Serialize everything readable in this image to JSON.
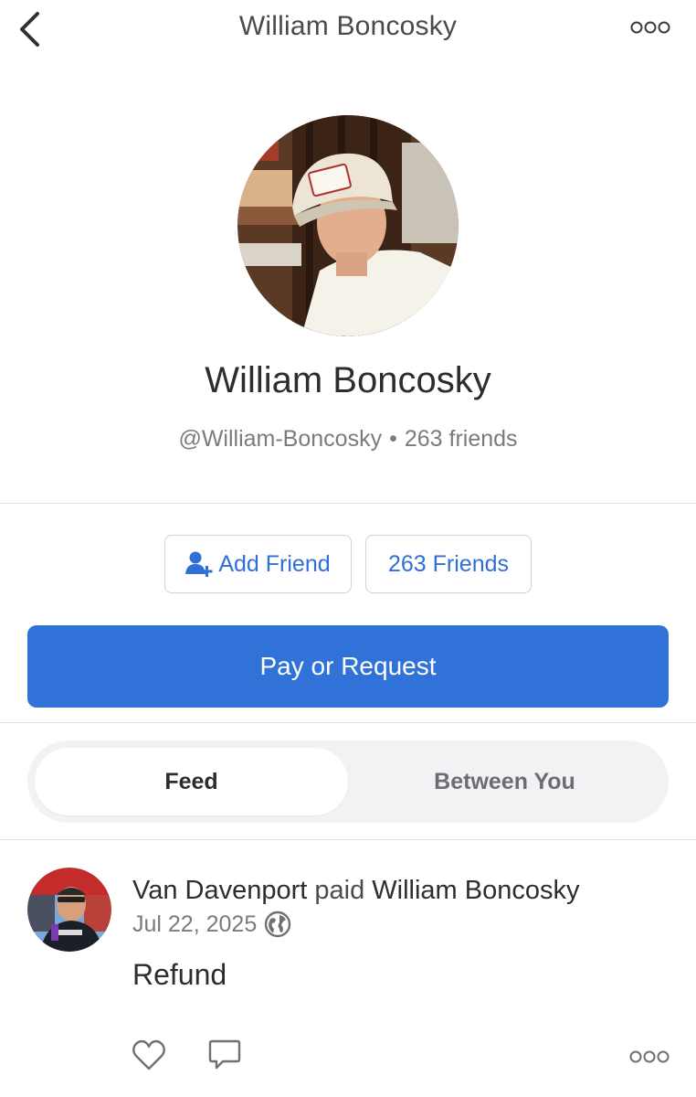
{
  "header": {
    "title": "William Boncosky",
    "back_icon": "chevron-left-icon",
    "more_icon": "more-dots-icon"
  },
  "profile": {
    "name": "William Boncosky",
    "username": "@William-Boncosky",
    "separator": "•",
    "friends_count_text": "263 friends"
  },
  "actions": {
    "add_friend_label": "Add Friend",
    "add_friend_icon": "add-person-icon",
    "friends_label": "263 Friends",
    "pay_request_label": "Pay or Request"
  },
  "tabs": [
    {
      "label": "Feed",
      "selected": true
    },
    {
      "label": "Between You",
      "selected": false
    }
  ],
  "feed": [
    {
      "actor": "Van Davenport",
      "verb": "paid",
      "target": "William Boncosky",
      "date": "Jul 22, 2025",
      "privacy_icon": "globe-icon",
      "note": "Refund"
    }
  ],
  "colors": {
    "accent": "#3172d8",
    "link": "#2f6fd6",
    "text": "#2c2d30",
    "muted": "#7a7b80",
    "divider": "#e2e3e6",
    "segment_bg": "#f2f2f4"
  }
}
